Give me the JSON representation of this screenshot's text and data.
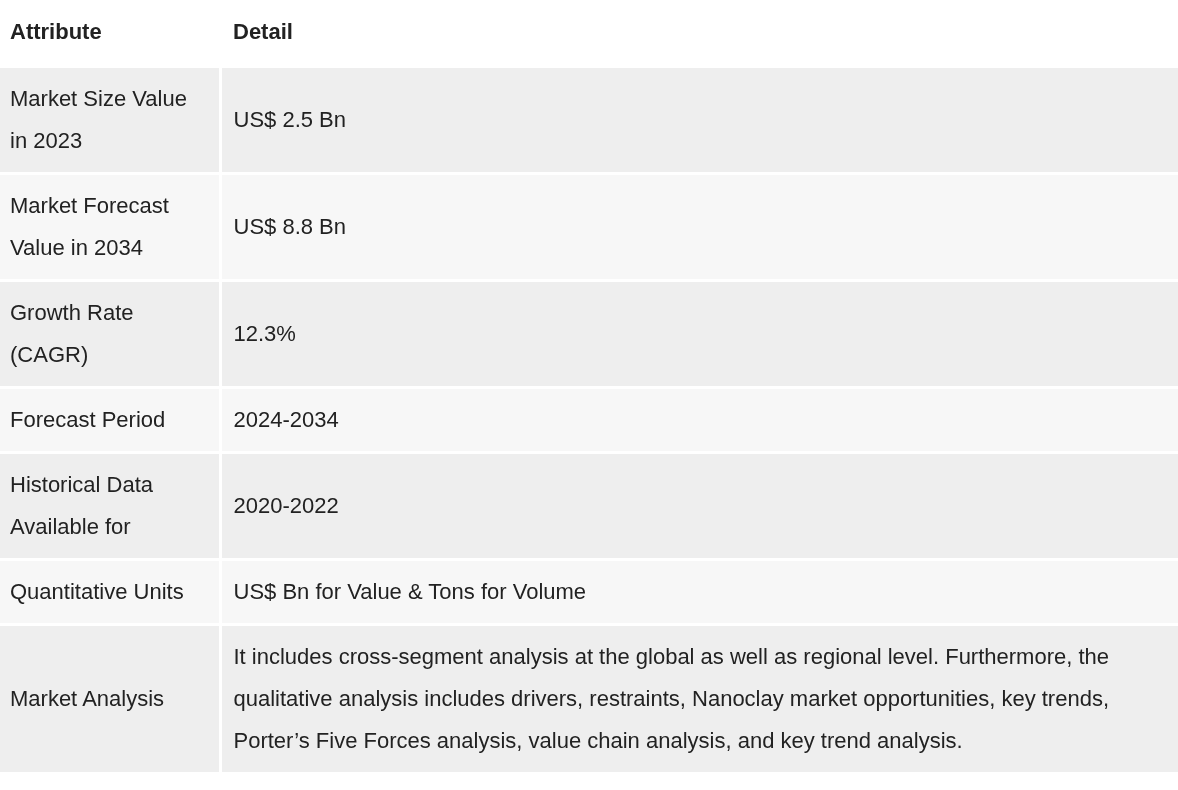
{
  "table": {
    "columns": [
      "Attribute",
      "Detail"
    ],
    "rows": [
      {
        "attribute": "Market Size Value in 2023",
        "detail": "US$ 2.5 Bn"
      },
      {
        "attribute": "Market Forecast Value in 2034",
        "detail": "US$ 8.8 Bn"
      },
      {
        "attribute": "Growth Rate (CAGR)",
        "detail": "12.3%"
      },
      {
        "attribute": "Forecast Period",
        "detail": "2024-2034"
      },
      {
        "attribute": "Historical Data Available for",
        "detail": "2020-2022"
      },
      {
        "attribute": "Quantitative Units",
        "detail": "US$ Bn for Value & Tons for Volume"
      },
      {
        "attribute": "Market Analysis",
        "detail": "It includes cross-segment analysis at the global as well as regional level. Furthermore, the qualitative analysis includes drivers, restraints, Nanoclay market opportunities, key trends, Porter’s Five Forces analysis, value chain analysis, and key trend analysis."
      }
    ]
  }
}
